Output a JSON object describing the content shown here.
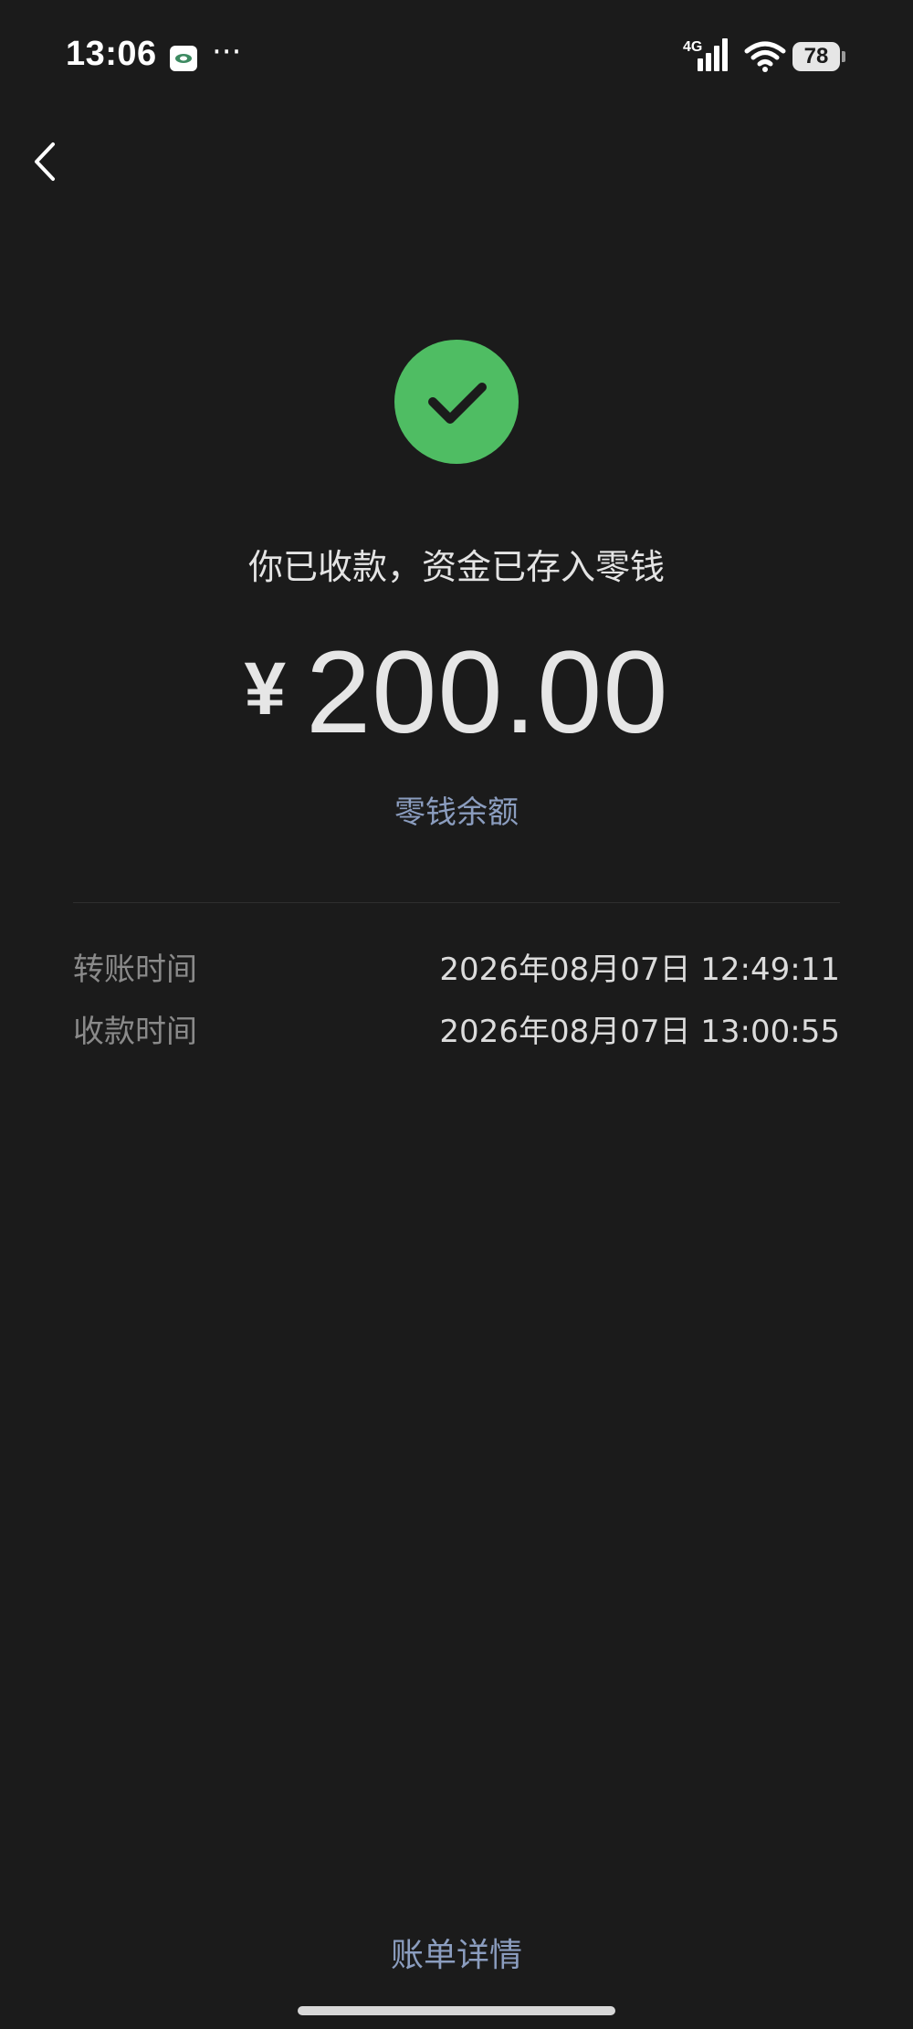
{
  "status_bar": {
    "time": "13:06",
    "more": "···",
    "network": "4G",
    "battery": "78"
  },
  "receipt": {
    "message": "你已收款，资金已存入零钱",
    "currency": "¥",
    "amount": "200.00",
    "balance_link": "零钱余额"
  },
  "details": [
    {
      "label": "转账时间",
      "value": "2026年08月07日 12:49:11"
    },
    {
      "label": "收款时间",
      "value": "2026年08月07日 13:00:55"
    }
  ],
  "footer": {
    "bill_details": "账单详情"
  },
  "colors": {
    "background": "#1b1b1b",
    "success": "#4fbd63",
    "link": "#8b9dbf"
  },
  "icons": {
    "back": "chevron-left-icon",
    "success": "check-circle-icon",
    "wifi": "wifi-icon",
    "battery": "battery-icon"
  }
}
